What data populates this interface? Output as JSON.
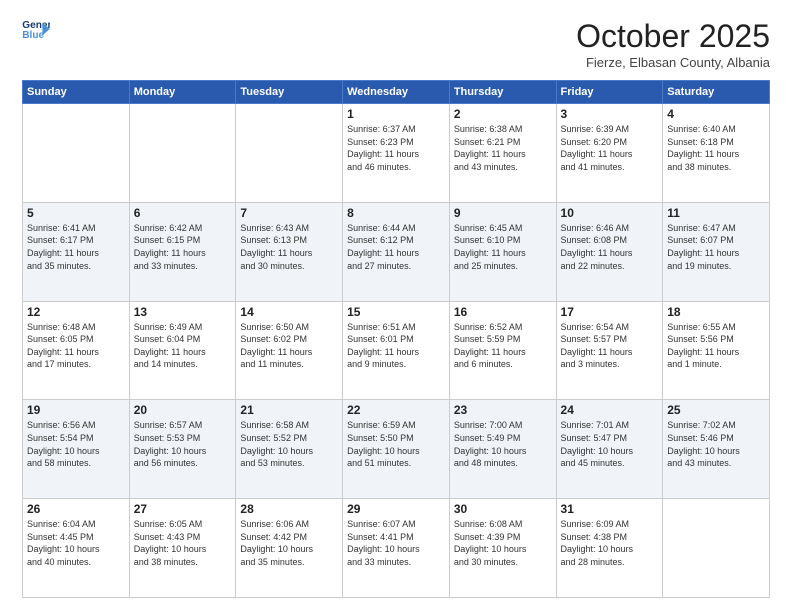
{
  "logo": {
    "line1": "General",
    "line2": "Blue",
    "arrow": "▶"
  },
  "header": {
    "month": "October 2025",
    "location": "Fierze, Elbasan County, Albania"
  },
  "weekdays": [
    "Sunday",
    "Monday",
    "Tuesday",
    "Wednesday",
    "Thursday",
    "Friday",
    "Saturday"
  ],
  "weeks": [
    [
      {
        "day": "",
        "info": ""
      },
      {
        "day": "",
        "info": ""
      },
      {
        "day": "",
        "info": ""
      },
      {
        "day": "1",
        "info": "Sunrise: 6:37 AM\nSunset: 6:23 PM\nDaylight: 11 hours\nand 46 minutes."
      },
      {
        "day": "2",
        "info": "Sunrise: 6:38 AM\nSunset: 6:21 PM\nDaylight: 11 hours\nand 43 minutes."
      },
      {
        "day": "3",
        "info": "Sunrise: 6:39 AM\nSunset: 6:20 PM\nDaylight: 11 hours\nand 41 minutes."
      },
      {
        "day": "4",
        "info": "Sunrise: 6:40 AM\nSunset: 6:18 PM\nDaylight: 11 hours\nand 38 minutes."
      }
    ],
    [
      {
        "day": "5",
        "info": "Sunrise: 6:41 AM\nSunset: 6:17 PM\nDaylight: 11 hours\nand 35 minutes."
      },
      {
        "day": "6",
        "info": "Sunrise: 6:42 AM\nSunset: 6:15 PM\nDaylight: 11 hours\nand 33 minutes."
      },
      {
        "day": "7",
        "info": "Sunrise: 6:43 AM\nSunset: 6:13 PM\nDaylight: 11 hours\nand 30 minutes."
      },
      {
        "day": "8",
        "info": "Sunrise: 6:44 AM\nSunset: 6:12 PM\nDaylight: 11 hours\nand 27 minutes."
      },
      {
        "day": "9",
        "info": "Sunrise: 6:45 AM\nSunset: 6:10 PM\nDaylight: 11 hours\nand 25 minutes."
      },
      {
        "day": "10",
        "info": "Sunrise: 6:46 AM\nSunset: 6:08 PM\nDaylight: 11 hours\nand 22 minutes."
      },
      {
        "day": "11",
        "info": "Sunrise: 6:47 AM\nSunset: 6:07 PM\nDaylight: 11 hours\nand 19 minutes."
      }
    ],
    [
      {
        "day": "12",
        "info": "Sunrise: 6:48 AM\nSunset: 6:05 PM\nDaylight: 11 hours\nand 17 minutes."
      },
      {
        "day": "13",
        "info": "Sunrise: 6:49 AM\nSunset: 6:04 PM\nDaylight: 11 hours\nand 14 minutes."
      },
      {
        "day": "14",
        "info": "Sunrise: 6:50 AM\nSunset: 6:02 PM\nDaylight: 11 hours\nand 11 minutes."
      },
      {
        "day": "15",
        "info": "Sunrise: 6:51 AM\nSunset: 6:01 PM\nDaylight: 11 hours\nand 9 minutes."
      },
      {
        "day": "16",
        "info": "Sunrise: 6:52 AM\nSunset: 5:59 PM\nDaylight: 11 hours\nand 6 minutes."
      },
      {
        "day": "17",
        "info": "Sunrise: 6:54 AM\nSunset: 5:57 PM\nDaylight: 11 hours\nand 3 minutes."
      },
      {
        "day": "18",
        "info": "Sunrise: 6:55 AM\nSunset: 5:56 PM\nDaylight: 11 hours\nand 1 minute."
      }
    ],
    [
      {
        "day": "19",
        "info": "Sunrise: 6:56 AM\nSunset: 5:54 PM\nDaylight: 10 hours\nand 58 minutes."
      },
      {
        "day": "20",
        "info": "Sunrise: 6:57 AM\nSunset: 5:53 PM\nDaylight: 10 hours\nand 56 minutes."
      },
      {
        "day": "21",
        "info": "Sunrise: 6:58 AM\nSunset: 5:52 PM\nDaylight: 10 hours\nand 53 minutes."
      },
      {
        "day": "22",
        "info": "Sunrise: 6:59 AM\nSunset: 5:50 PM\nDaylight: 10 hours\nand 51 minutes."
      },
      {
        "day": "23",
        "info": "Sunrise: 7:00 AM\nSunset: 5:49 PM\nDaylight: 10 hours\nand 48 minutes."
      },
      {
        "day": "24",
        "info": "Sunrise: 7:01 AM\nSunset: 5:47 PM\nDaylight: 10 hours\nand 45 minutes."
      },
      {
        "day": "25",
        "info": "Sunrise: 7:02 AM\nSunset: 5:46 PM\nDaylight: 10 hours\nand 43 minutes."
      }
    ],
    [
      {
        "day": "26",
        "info": "Sunrise: 6:04 AM\nSunset: 4:45 PM\nDaylight: 10 hours\nand 40 minutes."
      },
      {
        "day": "27",
        "info": "Sunrise: 6:05 AM\nSunset: 4:43 PM\nDaylight: 10 hours\nand 38 minutes."
      },
      {
        "day": "28",
        "info": "Sunrise: 6:06 AM\nSunset: 4:42 PM\nDaylight: 10 hours\nand 35 minutes."
      },
      {
        "day": "29",
        "info": "Sunrise: 6:07 AM\nSunset: 4:41 PM\nDaylight: 10 hours\nand 33 minutes."
      },
      {
        "day": "30",
        "info": "Sunrise: 6:08 AM\nSunset: 4:39 PM\nDaylight: 10 hours\nand 30 minutes."
      },
      {
        "day": "31",
        "info": "Sunrise: 6:09 AM\nSunset: 4:38 PM\nDaylight: 10 hours\nand 28 minutes."
      },
      {
        "day": "",
        "info": ""
      }
    ]
  ]
}
